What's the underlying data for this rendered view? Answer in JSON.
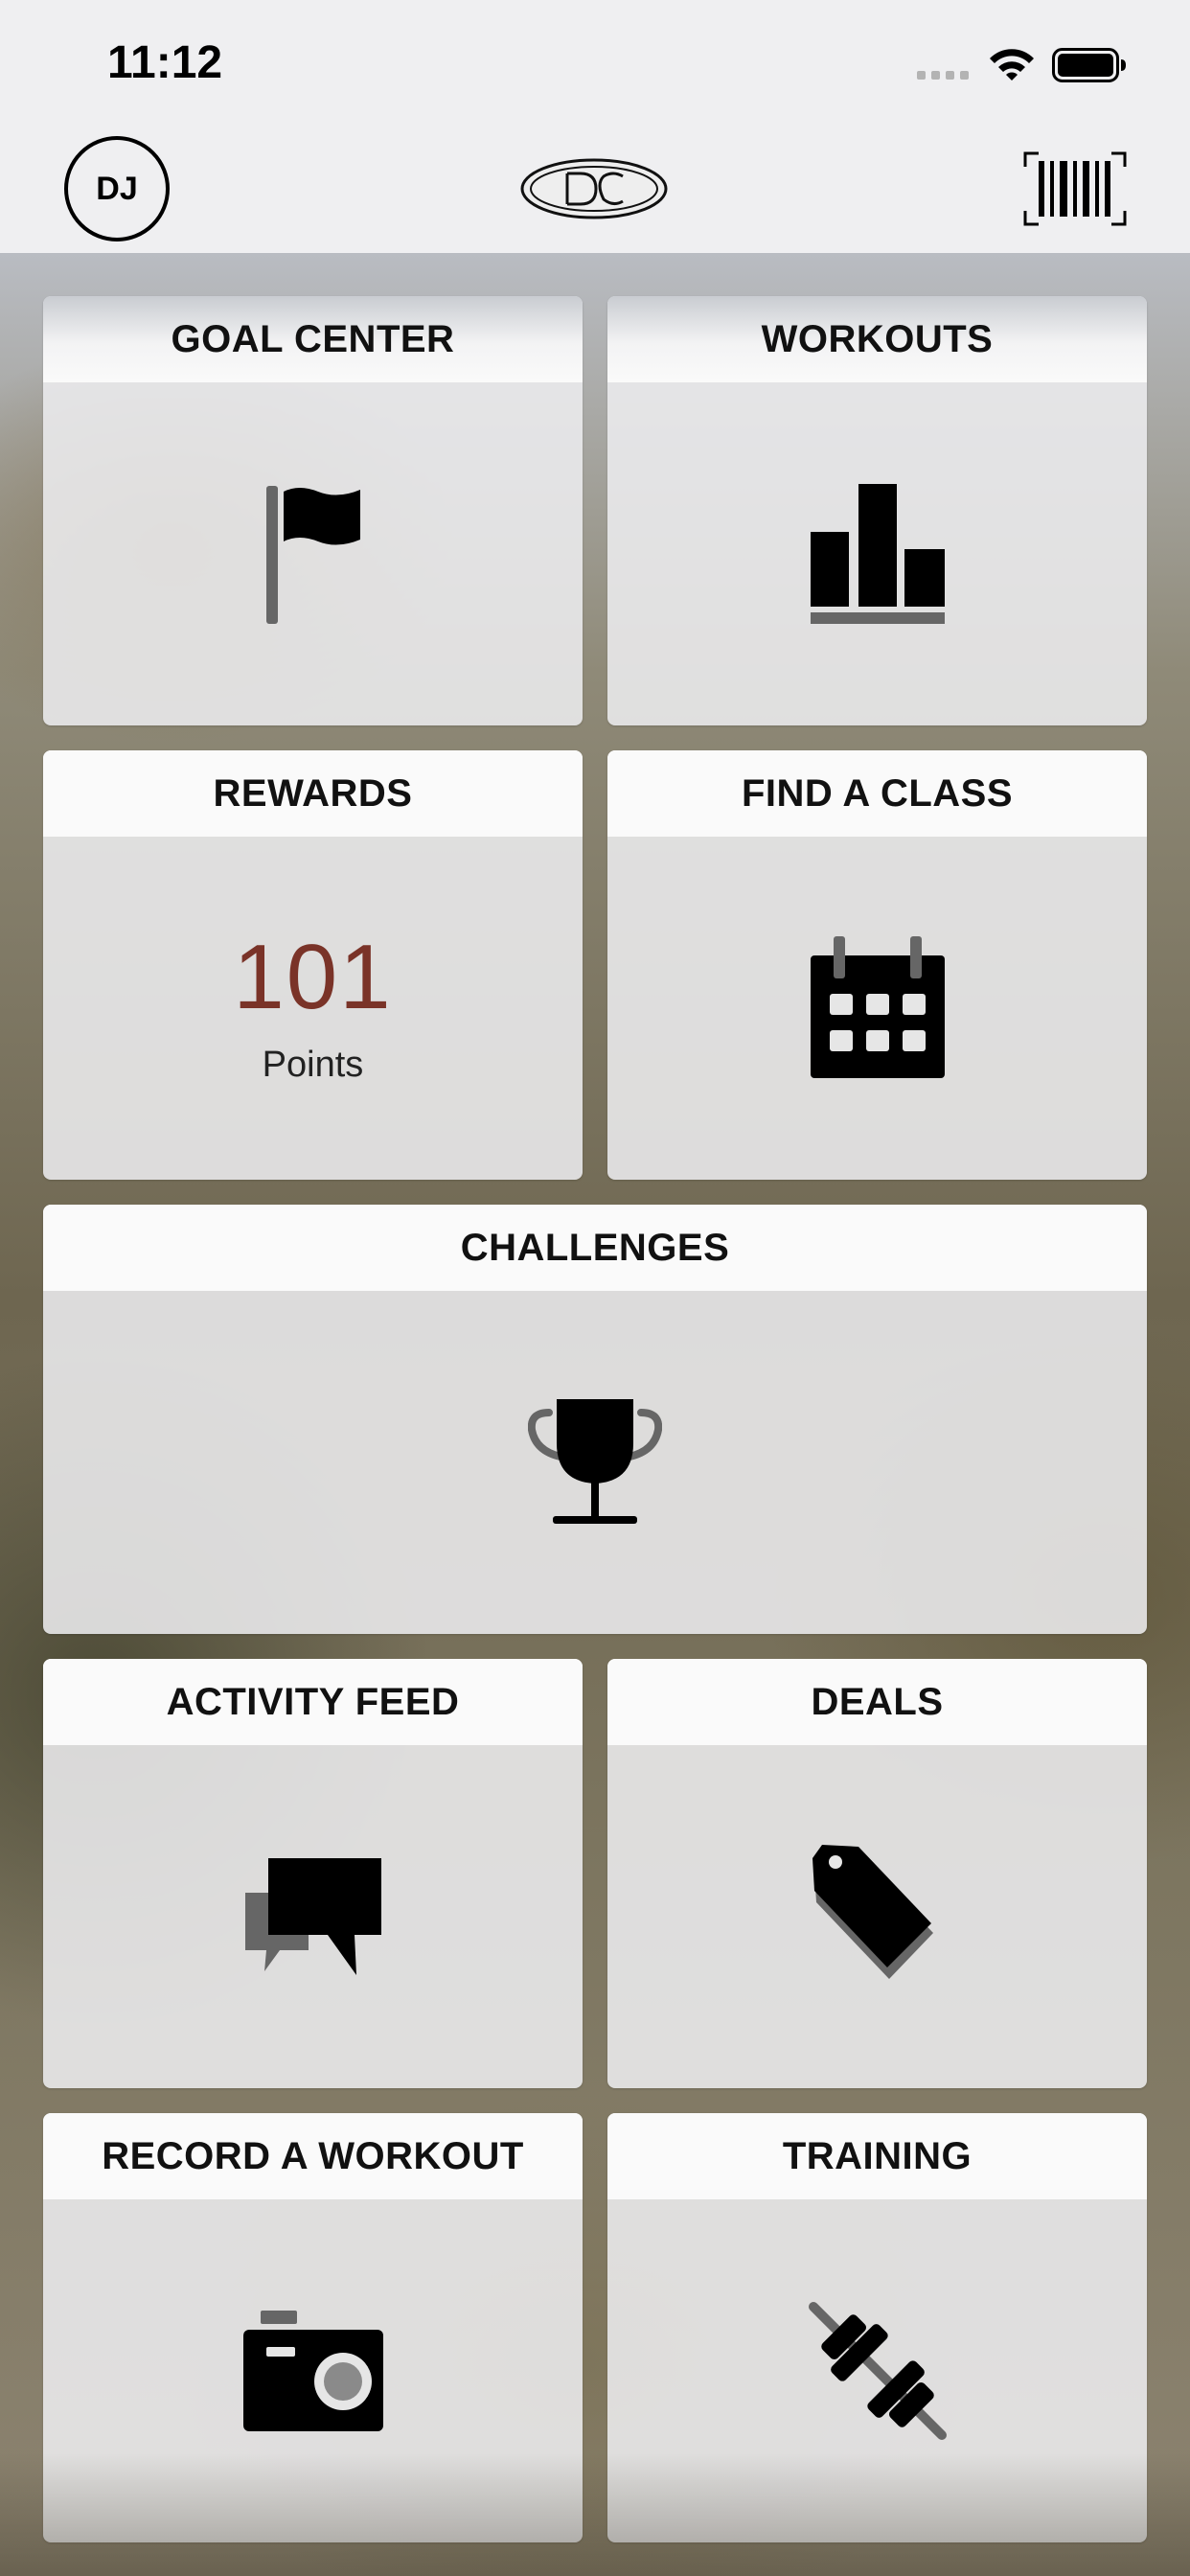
{
  "status_bar": {
    "time": "11:12"
  },
  "header": {
    "avatar_initials": "DJ",
    "logo_icon": "club-logo",
    "barcode_icon": "barcode-icon"
  },
  "tiles": {
    "goal_center": {
      "title": "GOAL CENTER",
      "icon": "flag-icon"
    },
    "workouts": {
      "title": "WORKOUTS",
      "icon": "bar-chart-icon"
    },
    "rewards": {
      "title": "REWARDS",
      "points_value": "101",
      "points_label": "Points"
    },
    "find_a_class": {
      "title": "FIND A CLASS",
      "icon": "calendar-icon"
    },
    "challenges": {
      "title": "CHALLENGES",
      "icon": "trophy-icon"
    },
    "activity_feed": {
      "title": "ACTIVITY FEED",
      "icon": "chat-bubbles-icon"
    },
    "deals": {
      "title": "DEALS",
      "icon": "tag-icon"
    },
    "record_a_workout": {
      "title": "RECORD A WORKOUT",
      "icon": "camera-icon"
    },
    "training": {
      "title": "TRAINING",
      "icon": "dumbbell-icon"
    }
  },
  "colors": {
    "points_accent": "#7a3328",
    "icon_dark": "#000000",
    "icon_gray": "#666666"
  }
}
